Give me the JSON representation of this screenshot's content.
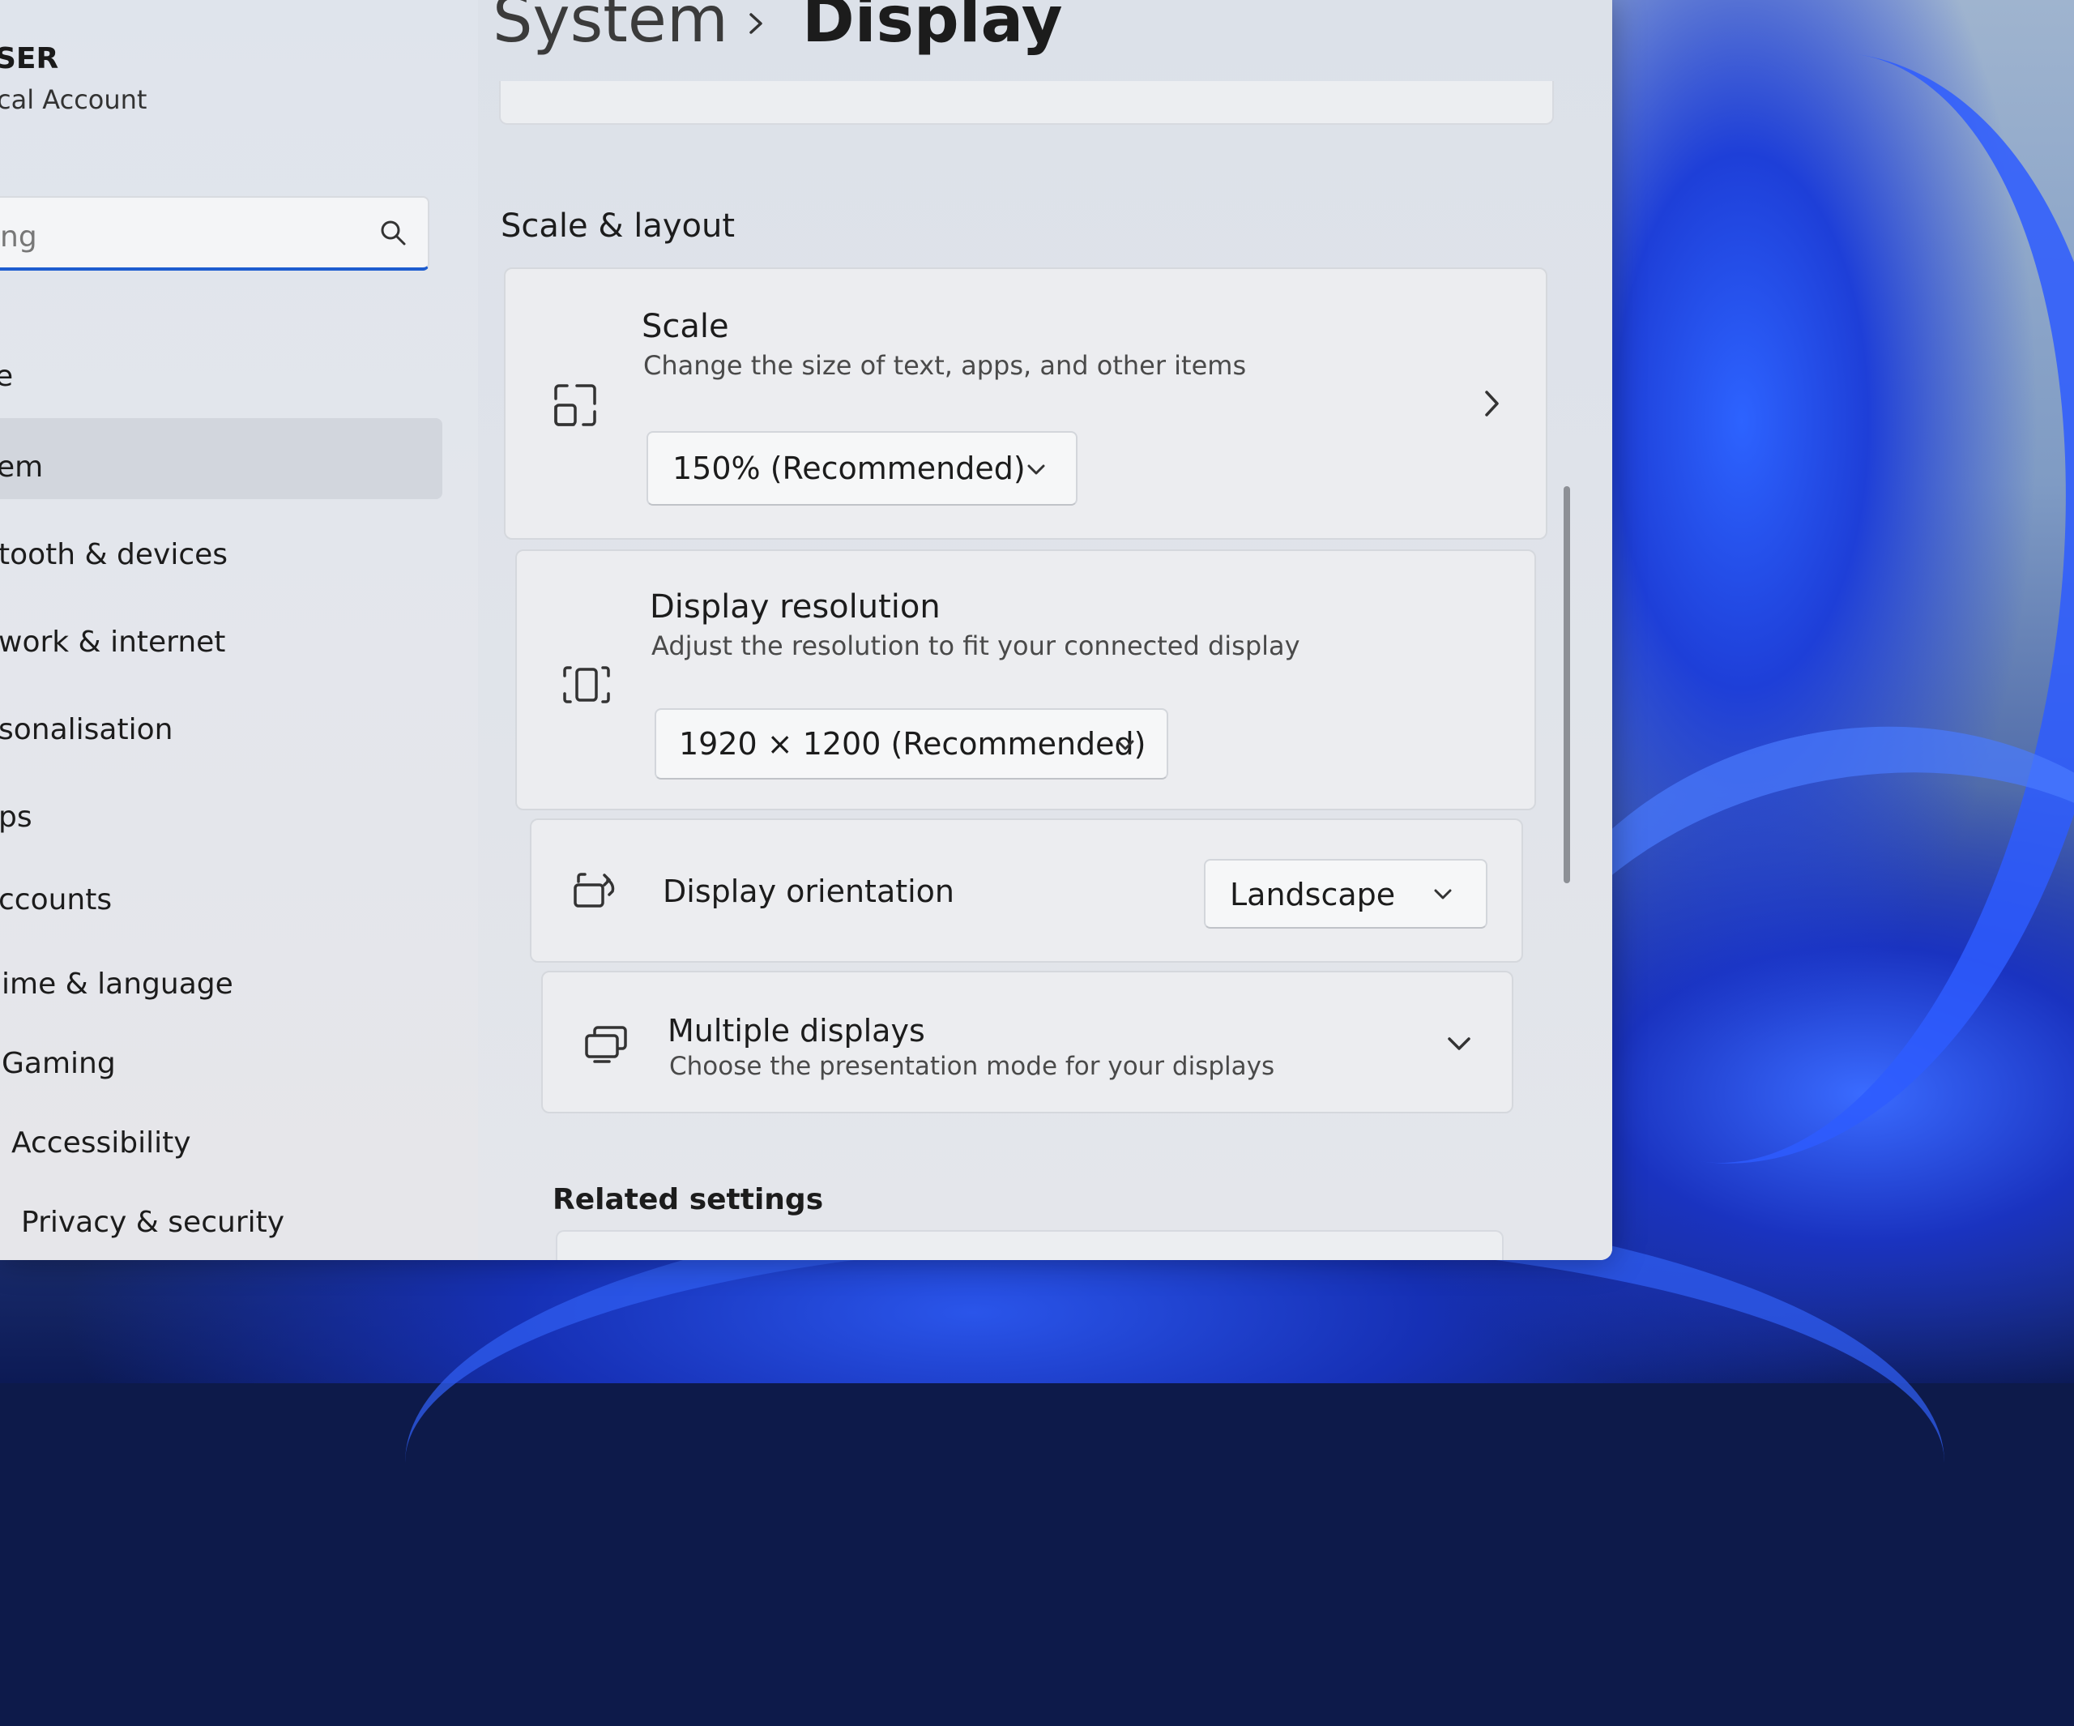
{
  "account": {
    "name": "SER",
    "type": "cal Account"
  },
  "search": {
    "value": "ng"
  },
  "nav": [
    {
      "label": "e"
    },
    {
      "label": "em"
    },
    {
      "label": "tooth & devices"
    },
    {
      "label": "work & internet"
    },
    {
      "label": "sonalisation"
    },
    {
      "label": "ps"
    },
    {
      "label": "ccounts"
    },
    {
      "label": "ime & language"
    },
    {
      "label": "Gaming"
    },
    {
      "label": "Accessibility"
    },
    {
      "label": "Privacy & security"
    }
  ],
  "breadcrumb": {
    "parent": "System",
    "current": "Display"
  },
  "scale_layout": {
    "title": "Scale & layout",
    "scale": {
      "title": "Scale",
      "desc": "Change the size of text, apps, and other items",
      "value": "150% (Recommended)"
    },
    "resolution": {
      "title": "Display resolution",
      "desc": "Adjust the resolution to fit your connected display",
      "value": "1920 × 1200 (Recommended)"
    },
    "orientation": {
      "title": "Display orientation",
      "value": "Landscape"
    },
    "multiple": {
      "title": "Multiple displays",
      "desc": "Choose the presentation mode for your displays"
    }
  },
  "related": {
    "title": "Related settings"
  },
  "icons": [
    "search-icon",
    "chevron-right-icon",
    "scale-icon",
    "resolution-icon",
    "orientation-icon",
    "multiple-displays-icon",
    "chevron-down-icon"
  ]
}
